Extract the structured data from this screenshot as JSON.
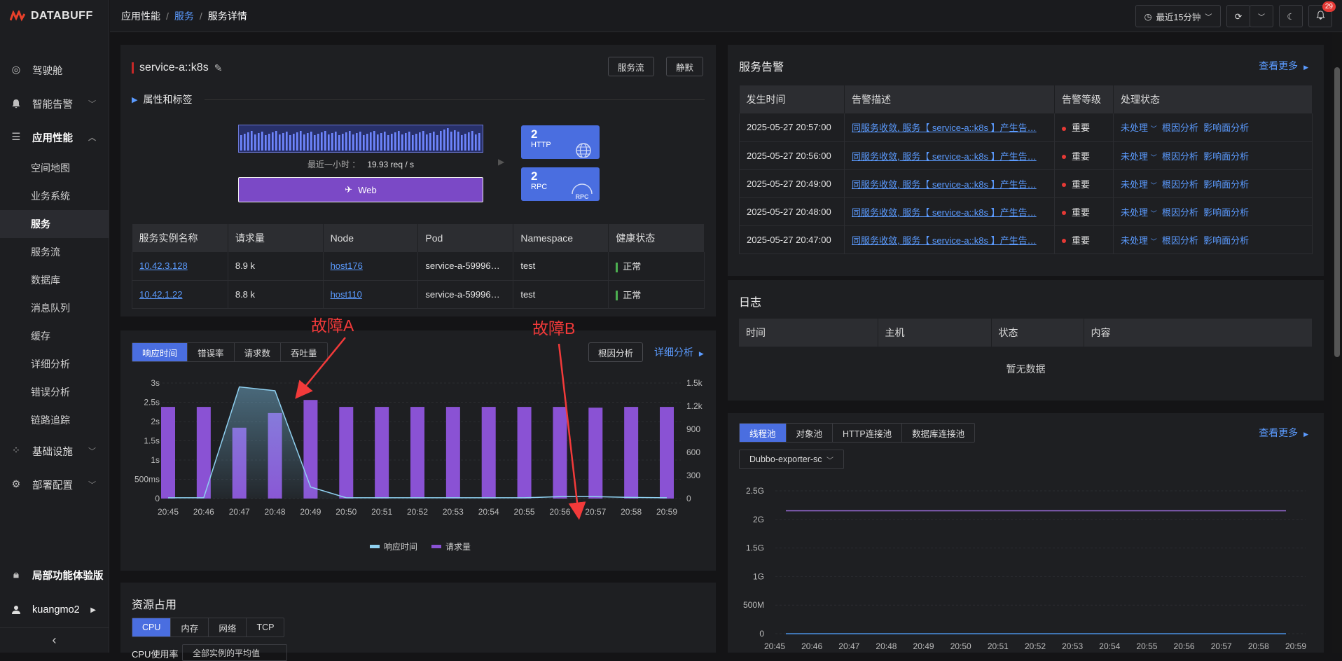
{
  "brand": "DATABUFF",
  "nav": {
    "cockpit": "驾驶舱",
    "alerts": "智能告警",
    "apm": "应用性能",
    "sub": [
      "空间地图",
      "业务系统",
      "服务",
      "服务流",
      "数据库",
      "消息队列",
      "缓存",
      "详细分析",
      "错误分析",
      "链路追踪"
    ],
    "infra": "基础设施",
    "deploy": "部署配置",
    "trial": "局部功能体验版",
    "user": "kuangmo2",
    "collapse": "‹"
  },
  "breadcrumb": {
    "a": "应用性能",
    "b": "服务",
    "c": "服务详情",
    "sep": "/"
  },
  "topbar": {
    "time_range": "最近15分钟",
    "notify_count": "29"
  },
  "service": {
    "name": "service-a::k8s",
    "flow_btn": "服务流",
    "mute_btn": "静默",
    "attrs": "属性和标签",
    "rate_label": "最近一小时 ：",
    "rate_value": "19.93 req / s",
    "web_label": "Web",
    "http": {
      "num": "2",
      "label": "HTTP"
    },
    "rpc": {
      "num": "2",
      "label": "RPC"
    }
  },
  "instances": {
    "headers": [
      "服务实例名称",
      "请求量",
      "Node",
      "Pod",
      "Namespace",
      "健康状态"
    ],
    "rows": [
      {
        "name": "10.42.3.128",
        "req": "8.9 k",
        "node": "host176",
        "pod": "service-a-59996…",
        "ns": "test",
        "health": "正常"
      },
      {
        "name": "10.42.1.22",
        "req": "8.8 k",
        "node": "host110",
        "pod": "service-a-59996…",
        "ns": "test",
        "health": "正常"
      }
    ]
  },
  "metric_tabs": [
    "响应时间",
    "错误率",
    "请求数",
    "吞吐量"
  ],
  "root_cause_btn": "根因分析",
  "detail_link": "详细分析",
  "annotations": {
    "a": "故障A",
    "b": "故障B"
  },
  "chart_data": [
    {
      "type": "bar+line",
      "categories": [
        "20:45",
        "20:46",
        "20:47",
        "20:48",
        "20:49",
        "20:50",
        "20:51",
        "20:52",
        "20:53",
        "20:54",
        "20:55",
        "20:56",
        "20:57",
        "20:58",
        "20:59"
      ],
      "series": [
        {
          "name": "响应时间",
          "type": "area",
          "axis": "left",
          "unit": "s",
          "values": [
            0.02,
            0.02,
            2.9,
            2.8,
            0.3,
            0.02,
            0.02,
            0.02,
            0.02,
            0.02,
            0.02,
            0.05,
            0.05,
            0.03,
            0.02
          ]
        },
        {
          "name": "请求量",
          "type": "bar",
          "axis": "right",
          "values": [
            1190,
            1190,
            920,
            1110,
            1280,
            1190,
            1190,
            1190,
            1190,
            1190,
            1190,
            1190,
            1180,
            1190,
            1190
          ]
        }
      ],
      "y_left_ticks": [
        "0",
        "500ms",
        "1s",
        "1.5s",
        "2s",
        "2.5s",
        "3s"
      ],
      "y_right_ticks": [
        "0",
        "300",
        "600",
        "900",
        "1.2k",
        "1.5k"
      ],
      "ylim_left": [
        0,
        3
      ],
      "ylim_right": [
        0,
        1500
      ],
      "legend": "bottom"
    },
    {
      "type": "line",
      "categories": [
        "20:45",
        "20:46",
        "20:47",
        "20:48",
        "20:49",
        "20:50",
        "20:51",
        "20:52",
        "20:53",
        "20:54",
        "20:55",
        "20:56",
        "20:57",
        "20:58",
        "20:59"
      ],
      "series": [
        {
          "color": "#a070e0",
          "values": [
            2.15,
            2.15,
            2.15,
            2.15,
            2.15,
            2.15,
            2.15,
            2.15,
            2.15,
            2.15,
            2.15,
            2.15,
            2.15,
            2.15,
            2.15
          ]
        },
        {
          "color": "#4a90e2",
          "values": [
            0,
            0,
            0,
            0,
            0,
            0,
            0,
            0,
            0,
            0,
            0,
            0,
            0,
            0,
            0
          ]
        }
      ],
      "y_ticks": [
        "0",
        "500M",
        "1G",
        "1.5G",
        "2G",
        "2.5G"
      ],
      "ylim": [
        0,
        2.5
      ]
    }
  ],
  "resources": {
    "title": "资源占用",
    "tabs": [
      "CPU",
      "内存",
      "网络",
      "TCP"
    ],
    "cpu_label": "CPU使用率",
    "cpu_select": "全部实例的平均值"
  },
  "alerts": {
    "title": "服务告警",
    "more": "查看更多",
    "headers": [
      "发生时间",
      "告警描述",
      "告警等级",
      "处理状态"
    ],
    "rows": [
      {
        "time": "2025-05-27 20:57:00",
        "desc": "同服务收敛, 服务【 service-a::k8s 】产生告…",
        "level": "重要"
      },
      {
        "time": "2025-05-27 20:56:00",
        "desc": "同服务收敛, 服务【 service-a::k8s 】产生告…",
        "level": "重要"
      },
      {
        "time": "2025-05-27 20:49:00",
        "desc": "同服务收敛, 服务【 service-a::k8s 】产生告…",
        "level": "重要"
      },
      {
        "time": "2025-05-27 20:48:00",
        "desc": "同服务收敛, 服务【 service-a::k8s 】产生告…",
        "level": "重要"
      },
      {
        "time": "2025-05-27 20:47:00",
        "desc": "同服务收敛, 服务【 service-a::k8s 】产生告…",
        "level": "重要"
      }
    ],
    "status": "未处理",
    "root": "根因分析",
    "impact": "影响面分析"
  },
  "logs": {
    "title": "日志",
    "headers": [
      "时间",
      "主机",
      "状态",
      "内容"
    ],
    "empty": "暂无数据"
  },
  "pools": {
    "tabs": [
      "线程池",
      "对象池",
      "HTTP连接池",
      "数据库连接池"
    ],
    "more": "查看更多",
    "select": "Dubbo-exporter-sc"
  }
}
